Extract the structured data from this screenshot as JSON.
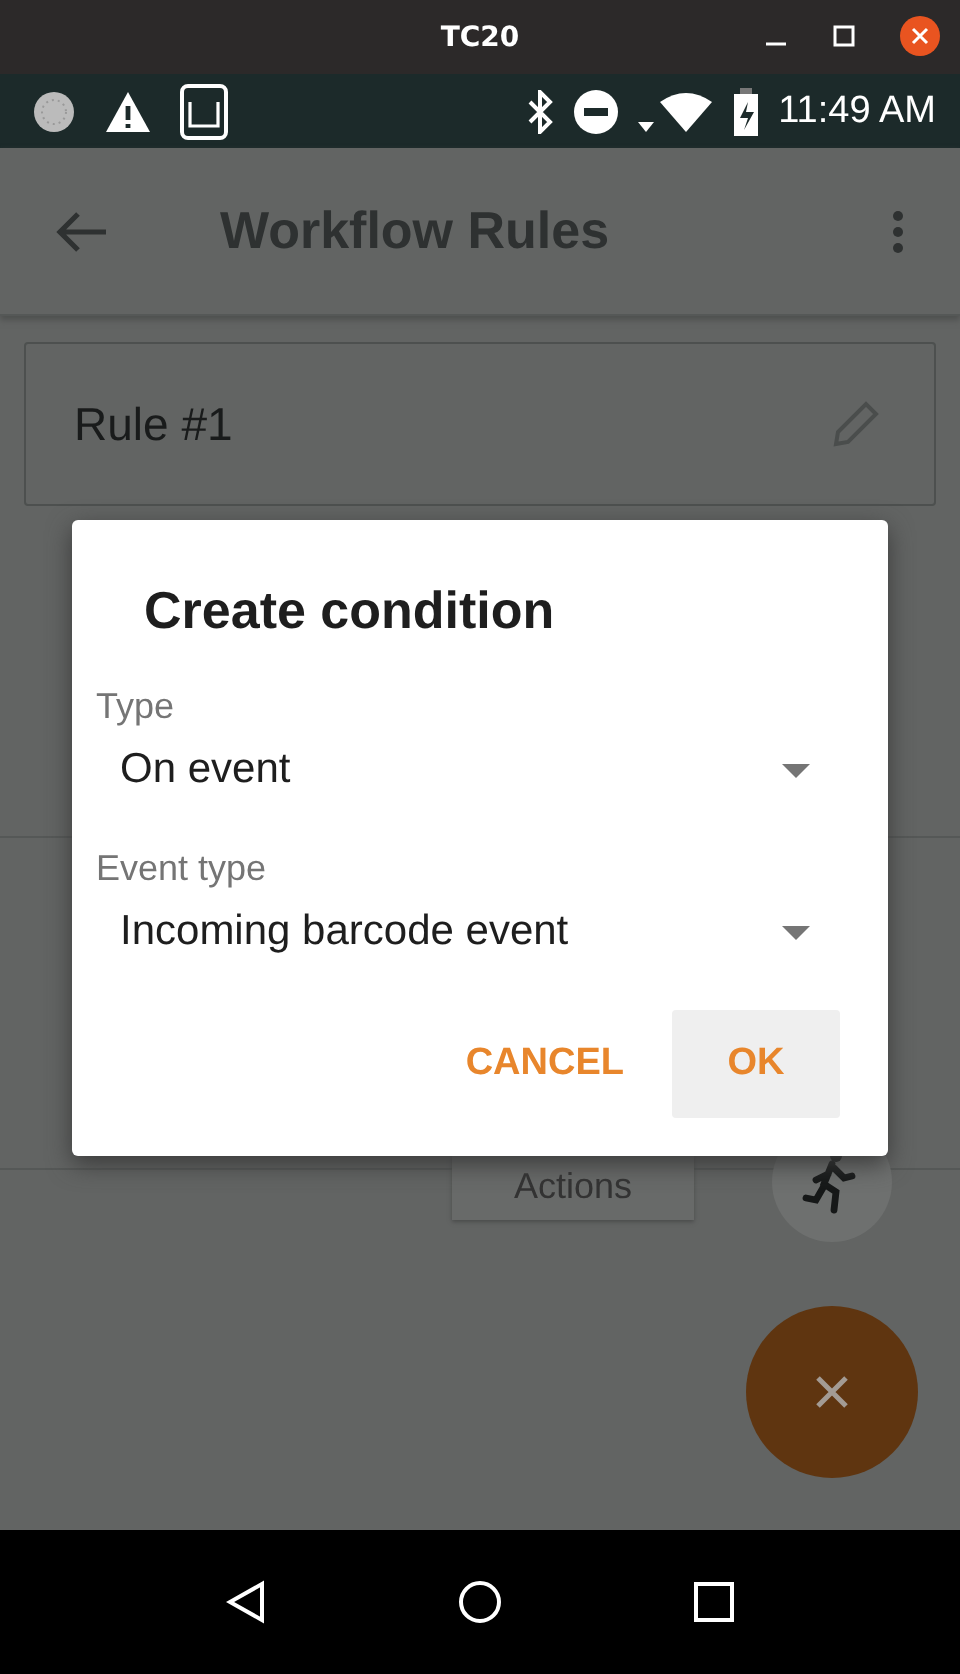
{
  "window": {
    "title": "TC20"
  },
  "status_bar": {
    "time": "11:49 AM"
  },
  "app_bar": {
    "title": "Workflow Rules"
  },
  "rule": {
    "name": "Rule #1"
  },
  "actions_button": {
    "label": "Actions"
  },
  "dialog": {
    "title": "Create condition",
    "fields": [
      {
        "label": "Type",
        "value": "On event"
      },
      {
        "label": "Event type",
        "value": "Incoming barcode event"
      }
    ],
    "buttons": [
      {
        "label": "CANCEL",
        "selected": false
      },
      {
        "label": "OK",
        "selected": true
      }
    ]
  }
}
